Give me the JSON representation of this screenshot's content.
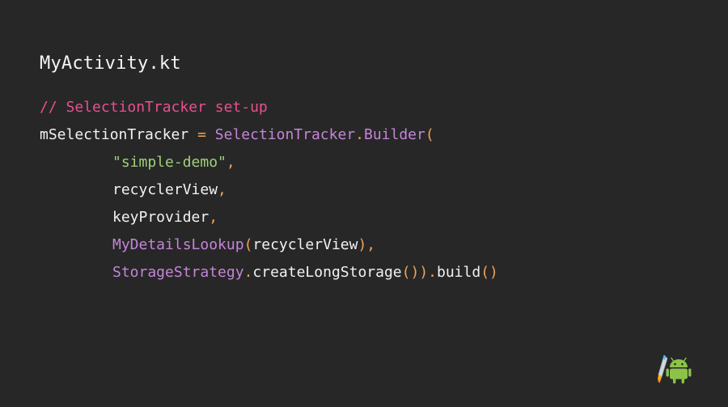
{
  "slide": {
    "title": "MyActivity.kt"
  },
  "code": {
    "lines": [
      {
        "indent": false,
        "tokens": [
          {
            "text": "// SelectionTracker set-up",
            "kind": "comment"
          }
        ]
      },
      {
        "indent": false,
        "tokens": [
          {
            "text": "mSelectionTracker ",
            "kind": "plain"
          },
          {
            "text": "=",
            "kind": "op"
          },
          {
            "text": " ",
            "kind": "plain"
          },
          {
            "text": "SelectionTracker",
            "kind": "type"
          },
          {
            "text": ".",
            "kind": "op"
          },
          {
            "text": "Builder",
            "kind": "type"
          },
          {
            "text": "(",
            "kind": "op"
          }
        ]
      },
      {
        "indent": true,
        "tokens": [
          {
            "text": "\"simple-demo\"",
            "kind": "string"
          },
          {
            "text": ",",
            "kind": "op"
          }
        ]
      },
      {
        "indent": true,
        "tokens": [
          {
            "text": "recyclerView",
            "kind": "plain"
          },
          {
            "text": ",",
            "kind": "op"
          }
        ]
      },
      {
        "indent": true,
        "tokens": [
          {
            "text": "keyProvider",
            "kind": "plain"
          },
          {
            "text": ",",
            "kind": "op"
          }
        ]
      },
      {
        "indent": true,
        "tokens": [
          {
            "text": "MyDetailsLookup",
            "kind": "type"
          },
          {
            "text": "(",
            "kind": "op"
          },
          {
            "text": "recyclerView",
            "kind": "plain"
          },
          {
            "text": "),",
            "kind": "op"
          }
        ]
      },
      {
        "indent": true,
        "tokens": [
          {
            "text": "StorageStrategy",
            "kind": "type"
          },
          {
            "text": ".",
            "kind": "op"
          },
          {
            "text": "createLongStorage",
            "kind": "plain"
          },
          {
            "text": "())",
            "kind": "op"
          },
          {
            "text": ".",
            "kind": "op"
          },
          {
            "text": "build",
            "kind": "plain"
          },
          {
            "text": "()",
            "kind": "op"
          }
        ]
      }
    ]
  },
  "colors": {
    "background": "#272727",
    "text": "#f2f2f2",
    "comment": "#e8508f",
    "operator": "#f0a35a",
    "type": "#c585d9",
    "string": "#9fd07a",
    "android_green": "#8bc34a"
  },
  "logo": {
    "icon": "android-studio-robot-icon"
  }
}
